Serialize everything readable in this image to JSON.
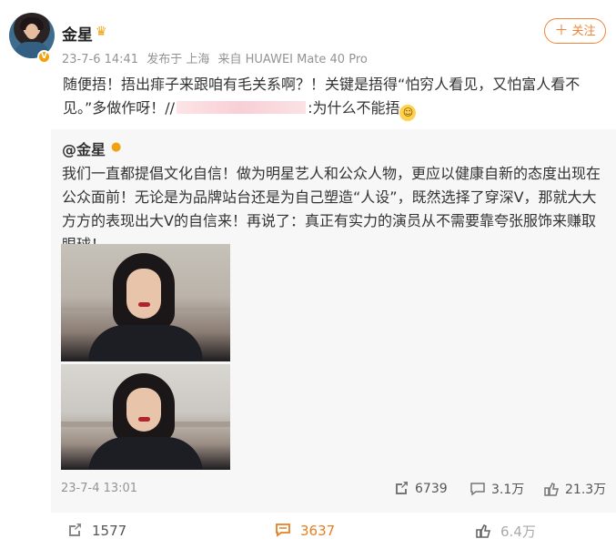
{
  "header": {
    "user_name": "金星",
    "verified_badge": "V",
    "meta_parts": [
      "23-7-6 14:41",
      "发布于 上海",
      "来自 HUAWEI Mate 40 Pro"
    ],
    "follow_label": "关注",
    "follow_icon": "plus"
  },
  "post": {
    "text_before_blur": "随便捂！捂出痱子来跟咱有毛关系啊？！关键是捂得“怕穷人看见，又怕富人看不见。”多做作呀！//",
    "text_after_blur": ":为什么不能捂",
    "emoji": "laugh-emoji"
  },
  "repost": {
    "name": "@金星",
    "badge": "V",
    "text": "我们一直都提倡文化自信！做为明星艺人和公众人物，更应以健康自新的态度出现在公众面前！无论是为品牌站台还是为自己塑造“人设”，既然选择了穿深V，那就大大方方的表现出大V的自信来！再说了：真正有实力的演员从不需要靠夸张服饰来赚取眼球！",
    "time": "23-7-4 13:01",
    "repost_count": "6739",
    "comment_count": "3.1万",
    "like_count": "21.3万"
  },
  "actions": {
    "repost_count": "1577",
    "comment_count": "3637",
    "like_count": "6.4万"
  },
  "colors": {
    "accent": "#f08335",
    "comment_accent": "#e67e22",
    "badge": "#f2a10f",
    "meta": "#939393",
    "repost_bg": "#f7f7f7"
  }
}
